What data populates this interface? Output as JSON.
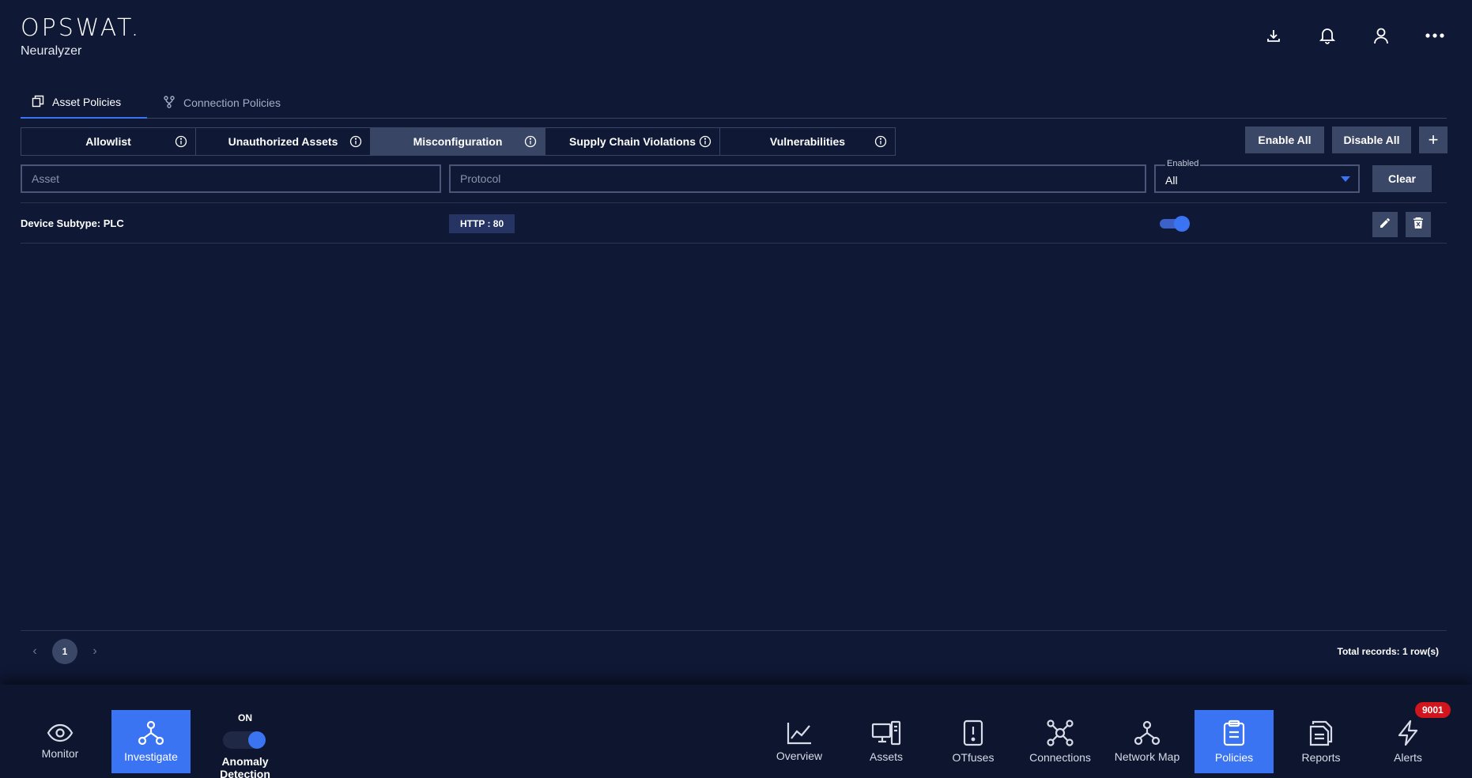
{
  "header": {
    "logo": "OPSWAT.",
    "product": "Neuralyzer",
    "icons": [
      "download-icon",
      "bell-icon",
      "user-icon",
      "more-icon"
    ]
  },
  "top_tabs": [
    {
      "label": "Asset Policies",
      "icon": "asset-policies-icon",
      "active": true
    },
    {
      "label": "Connection Policies",
      "icon": "connection-policies-icon",
      "active": false
    }
  ],
  "sub_tabs": [
    {
      "label": "Allowlist",
      "active": false
    },
    {
      "label": "Unauthorized Assets",
      "active": false
    },
    {
      "label": "Misconfiguration",
      "active": true
    },
    {
      "label": "Supply Chain Violations",
      "active": false
    },
    {
      "label": "Vulnerabilities",
      "active": false
    }
  ],
  "actions": {
    "enable_all": "Enable All",
    "disable_all": "Disable All",
    "add": "+"
  },
  "filters": {
    "asset_placeholder": "Asset",
    "protocol_placeholder": "Protocol",
    "enabled_label": "Enabled",
    "enabled_value": "All",
    "clear": "Clear"
  },
  "rows": [
    {
      "asset": "Device Subtype: PLC",
      "protocol": "HTTP : 80",
      "enabled": true
    }
  ],
  "pagination": {
    "current_page": "1",
    "total": "Total records: 1 row(s)"
  },
  "bottom_nav": {
    "left": [
      {
        "label": "Monitor",
        "icon": "eye-icon",
        "active": false
      },
      {
        "label": "Investigate",
        "icon": "investigate-icon",
        "active": true
      }
    ],
    "anomaly": {
      "state": "ON",
      "label": "Anomaly Detection",
      "enabled": true
    },
    "right": [
      {
        "label": "Overview",
        "icon": "chart-icon",
        "active": false
      },
      {
        "label": "Assets",
        "icon": "assets-icon",
        "active": false
      },
      {
        "label": "OTfuses",
        "icon": "otfuses-icon",
        "active": false
      },
      {
        "label": "Connections",
        "icon": "connections-icon",
        "active": false
      },
      {
        "label": "Network Map",
        "icon": "network-map-icon",
        "active": false
      },
      {
        "label": "Policies",
        "icon": "clipboard-icon",
        "active": true
      },
      {
        "label": "Reports",
        "icon": "reports-icon",
        "active": false
      },
      {
        "label": "Alerts",
        "icon": "lightning-icon",
        "active": false
      }
    ],
    "alerts_count": "9001"
  },
  "colors": {
    "background": "#0f1835",
    "accent": "#3b74f3",
    "badge": "#d0151d",
    "button": "#3b4766"
  }
}
